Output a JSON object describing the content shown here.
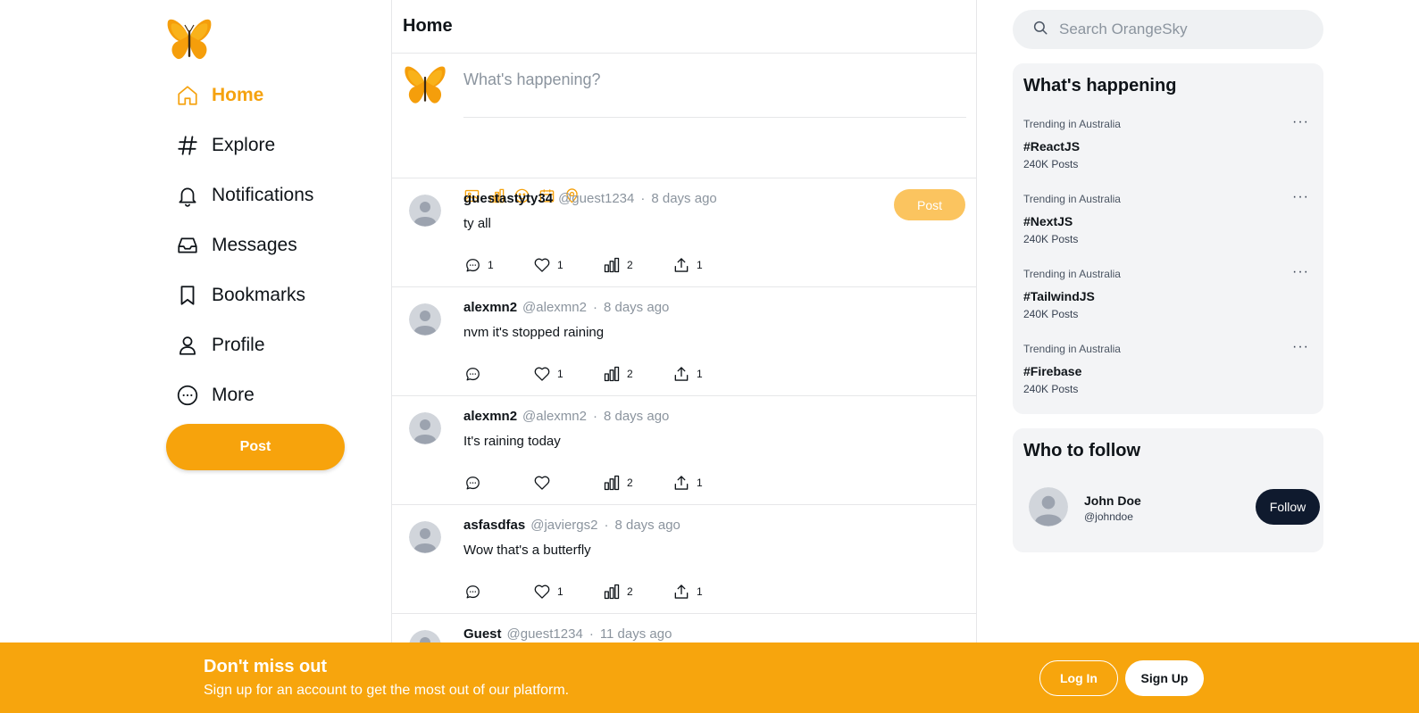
{
  "brand": {
    "logo_icon": "butterfly-icon",
    "accent": "#f7a30c"
  },
  "sidebar": {
    "items": [
      {
        "label": "Home",
        "icon": "home-icon",
        "active": true
      },
      {
        "label": "Explore",
        "icon": "hash-icon"
      },
      {
        "label": "Notifications",
        "icon": "bell-icon"
      },
      {
        "label": "Messages",
        "icon": "inbox-icon"
      },
      {
        "label": "Bookmarks",
        "icon": "bookmark-icon"
      },
      {
        "label": "Profile",
        "icon": "user-icon"
      },
      {
        "label": "More",
        "icon": "more-circle-icon"
      }
    ],
    "post_label": "Post"
  },
  "main": {
    "title": "Home",
    "composer": {
      "placeholder": "What's happening?",
      "post_label": "Post",
      "tools": [
        "image-icon",
        "poll-icon",
        "emoji-icon",
        "schedule-icon",
        "location-icon"
      ]
    },
    "tweets": [
      {
        "name": "guestastyty34",
        "handle": "@guest1234",
        "time": "8 days ago",
        "text": "ty all",
        "replies": "1",
        "likes": "1",
        "views": "2",
        "shares": "1"
      },
      {
        "name": "alexmn2",
        "handle": "@alexmn2",
        "time": "8 days ago",
        "text": "nvm it's stopped raining",
        "replies": "",
        "likes": "1",
        "views": "2",
        "shares": "1"
      },
      {
        "name": "alexmn2",
        "handle": "@alexmn2",
        "time": "8 days ago",
        "text": "It's raining today",
        "replies": "",
        "likes": "",
        "views": "2",
        "shares": "1"
      },
      {
        "name": "asfasdfas",
        "handle": "@javiergs2",
        "time": "8 days ago",
        "text": "Wow that's a butterfly",
        "replies": "",
        "likes": "1",
        "views": "2",
        "shares": "1"
      },
      {
        "name": "Guest",
        "handle": "@guest1234",
        "time": "11 days ago",
        "text": "",
        "replies": "",
        "likes": "",
        "views": "",
        "shares": ""
      }
    ],
    "dot": "·"
  },
  "right": {
    "search_placeholder": "Search OrangeSky",
    "trends_title": "What's happening",
    "trends": [
      {
        "meta": "Trending in Australia",
        "tag": "#ReactJS",
        "count": "240K Posts"
      },
      {
        "meta": "Trending in Australia",
        "tag": "#NextJS",
        "count": "240K Posts"
      },
      {
        "meta": "Trending in Australia",
        "tag": "#TailwindJS",
        "count": "240K Posts"
      },
      {
        "meta": "Trending in Australia",
        "tag": "#Firebase",
        "count": "240K Posts"
      }
    ],
    "more_glyph": "···",
    "follow_title": "Who to follow",
    "follow": {
      "name": "John Doe",
      "handle": "@johndoe",
      "button": "Follow"
    }
  },
  "banner": {
    "title": "Don't miss out",
    "subtitle": "Sign up for an account to get the most out of our platform.",
    "login": "Log In",
    "signup": "Sign Up"
  }
}
